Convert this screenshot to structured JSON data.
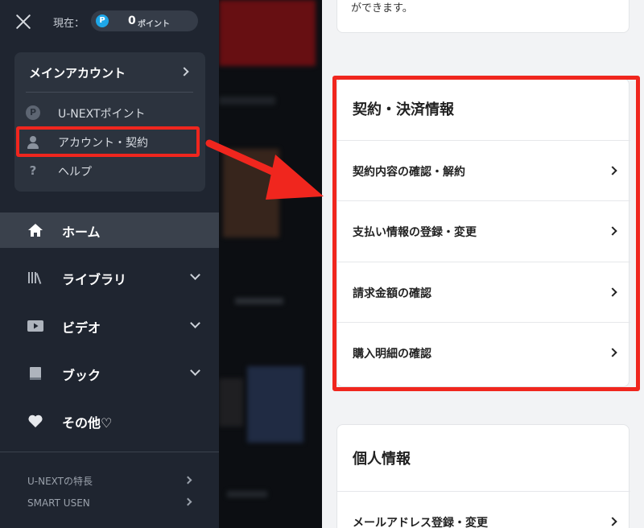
{
  "header": {
    "current_label": "現在：",
    "points_badge": "P",
    "points_value": "0",
    "points_unit": "ポイント"
  },
  "account": {
    "title": "メインアカウント",
    "items": [
      {
        "label": "U-NEXTポイント",
        "icon": "points-icon"
      },
      {
        "label": "アカウント・契約",
        "icon": "user-icon"
      },
      {
        "label": "ヘルプ",
        "icon": "help-icon"
      }
    ]
  },
  "nav": {
    "items": [
      {
        "label": "ホーム",
        "icon": "home-icon",
        "active": true
      },
      {
        "label": "ライブラリ",
        "icon": "library-icon",
        "expandable": true
      },
      {
        "label": "ビデオ",
        "icon": "video-icon",
        "expandable": true
      },
      {
        "label": "ブック",
        "icon": "book-icon",
        "expandable": true
      },
      {
        "label": "その他♡",
        "icon": "heart-icon"
      }
    ]
  },
  "footer": {
    "items": [
      {
        "label": "U-NEXTの特長"
      },
      {
        "label": "SMART USEN"
      }
    ]
  },
  "right": {
    "top_snippet": "ができます。",
    "contract": {
      "title": "契約・決済情報",
      "rows": [
        {
          "label": "契約内容の確認・解約"
        },
        {
          "label": "支払い情報の登録・変更"
        },
        {
          "label": "請求金額の確認"
        },
        {
          "label": "購入明細の確認"
        }
      ]
    },
    "personal": {
      "title": "個人情報",
      "rows": [
        {
          "label": "メールアドレス登録・変更"
        }
      ]
    }
  },
  "colors": {
    "highlight": "#f0261e",
    "panel_dark": "#1f2530",
    "points_badge": "#1ea7e8"
  }
}
